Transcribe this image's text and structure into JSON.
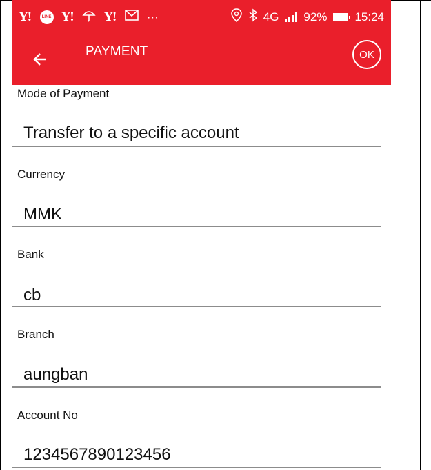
{
  "status_bar": {
    "yahoo_1": "Y!",
    "line_badge": "LINE",
    "yahoo_2": "Y!",
    "yahoo_3": "Y!",
    "more": "···",
    "network": "4G",
    "battery": "92%",
    "time": "15:24"
  },
  "appbar": {
    "title": "PAYMENT",
    "ok_label": "OK",
    "accent_color": "#ea1f2b"
  },
  "form": {
    "fields": [
      {
        "label": "Mode of Payment",
        "value": "Transfer to a specific account"
      },
      {
        "label": "Currency",
        "value": "MMK"
      },
      {
        "label": "Bank",
        "value": "cb"
      },
      {
        "label": "Branch",
        "value": "aungban"
      },
      {
        "label": "Account No",
        "value": "1234567890123456"
      }
    ]
  }
}
